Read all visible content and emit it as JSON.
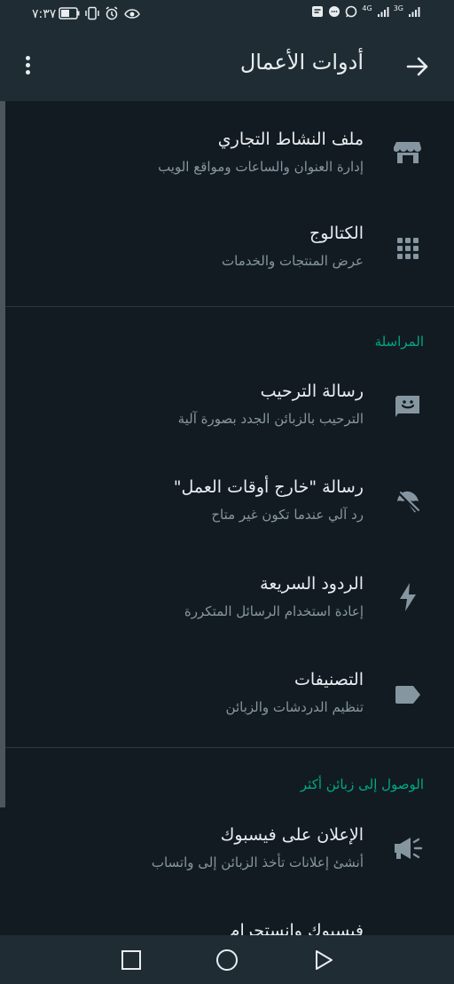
{
  "status_bar": {
    "time": "٧:٣٧",
    "network_left": "4G",
    "network_right": "3G"
  },
  "header": {
    "title": "أدوات الأعمال"
  },
  "colors": {
    "background": "#121b22",
    "bar": "#1f2c34",
    "accent": "#00a884",
    "secondary_text": "#8696a0"
  },
  "items": [
    {
      "title": "ملف النشاط التجاري",
      "subtitle": "إدارة العنوان والساعات ومواقع الويب",
      "icon": "store-icon"
    },
    {
      "title": "الكتالوج",
      "subtitle": "عرض المنتجات والخدمات",
      "icon": "grid-icon"
    },
    {
      "title": "رسالة الترحيب",
      "subtitle": "الترحيب بالزبائن الجدد بصورة آلية",
      "icon": "welcome-message-icon"
    },
    {
      "title": "رسالة \"خارج أوقات العمل\"",
      "subtitle": "رد آلي عندما تكون غير متاح",
      "icon": "umbrella-off-icon"
    },
    {
      "title": "الردود السريعة",
      "subtitle": "إعادة استخدام الرسائل المتكررة",
      "icon": "lightning-icon"
    },
    {
      "title": "التصنيفات",
      "subtitle": "تنظيم الدردشات والزبائن",
      "icon": "label-icon"
    },
    {
      "title": "الإعلان على فيسبوك",
      "subtitle": "أنشئ إعلانات تأخذ الزبائن إلى واتساب",
      "icon": "megaphone-icon"
    },
    {
      "title": "فيسبوك وانستجرام",
      "subtitle": "",
      "icon": ""
    }
  ],
  "sections": {
    "messaging": "المراسلة",
    "reach": "الوصول إلى زبائن أكثر"
  }
}
